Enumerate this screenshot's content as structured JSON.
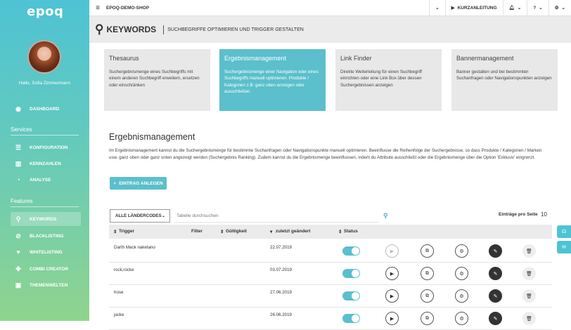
{
  "app": {
    "logo": "epoq",
    "greeting": "Hallo, Sofia Zimmermann"
  },
  "sidebar": {
    "dashboard": "DASHBOARD",
    "services_title": "Services",
    "services": [
      "KONFIGURATION",
      "KENNZAHLEN",
      "ANALYSE"
    ],
    "features_title": "Features",
    "features": [
      "KEYWORDS",
      "BLACKLISTING",
      "WHITELISTING",
      "COMBI CREATOR",
      "THEMENWELTEN"
    ]
  },
  "topbar": {
    "shop": "EPOQ-DEMO-SHOP",
    "guide": "KURZANLEITUNG",
    "help": "?"
  },
  "header": {
    "title": "KEYWORDS",
    "subtitle": "SUCHBEGRIFFE OPTIMIEREN UND TRIGGER GESTALTEN"
  },
  "tiles": [
    {
      "title": "Thesaurus",
      "desc": "Suchergebnismenge eines Suchbegriffs mit einem anderen Suchbegriff erweitern, ersetzen oder einschränken"
    },
    {
      "title": "Ergebnismanagement",
      "desc": "Suchergebnismenge einer Navigation oder eines Suchbegriffs manuell optimieren. Produkte / Kategorien z.B. ganz oben anzeigen oder ausschließen"
    },
    {
      "title": "Link Finder",
      "desc": "Direkte Weiterleitung für einen Suchbegriff einrichten oder eine Link Box über dessen Suchergebnissen anzeigen"
    },
    {
      "title": "Bannermanagement",
      "desc": "Banner gestalten und bei bestimmten Suchanfragen oder Navigationspunkten anzeigen"
    }
  ],
  "main": {
    "title": "Ergebnismanagement",
    "description": "Im Ergebnismanagement kannst du die Suchergebnismenge für bestimmte Suchanfragen oder Navigationspunkte manuell optimieren. Beeinflusse die Reihenfolge der Suchergebnisse, so dass Produkte / Kategorien / Marken usw. ganz oben oder ganz unten angezeigt werden (Suchergebnis Ranking). Zudem kannst du die Ergebnismenge beeinflussen, indem du Attribute ausschließt oder die Ergebnismenge über die Option 'Exklusiv' eingrenzt.",
    "add_button": "EINTRAG ANLEGEN",
    "country_select": "ALLE LÄNDERCODES",
    "search_placeholder": "Tabelle durchsuchen",
    "per_page_label": "Einträge pro Seite",
    "per_page_value": "10"
  },
  "table": {
    "headers": {
      "trigger": "Trigger",
      "filter": "Filter",
      "validity": "Gültigkeit",
      "changed": "zuletzt geändert",
      "status": "Status"
    },
    "rows": [
      {
        "trigger": "Darth Mack naketano",
        "date": "22.07.2019"
      },
      {
        "trigger": "rock,rocke",
        "date": "03.07.2019"
      },
      {
        "trigger": "hose",
        "date": "27.06.2019"
      },
      {
        "trigger": "jacke",
        "date": "26.06.2019"
      }
    ]
  }
}
